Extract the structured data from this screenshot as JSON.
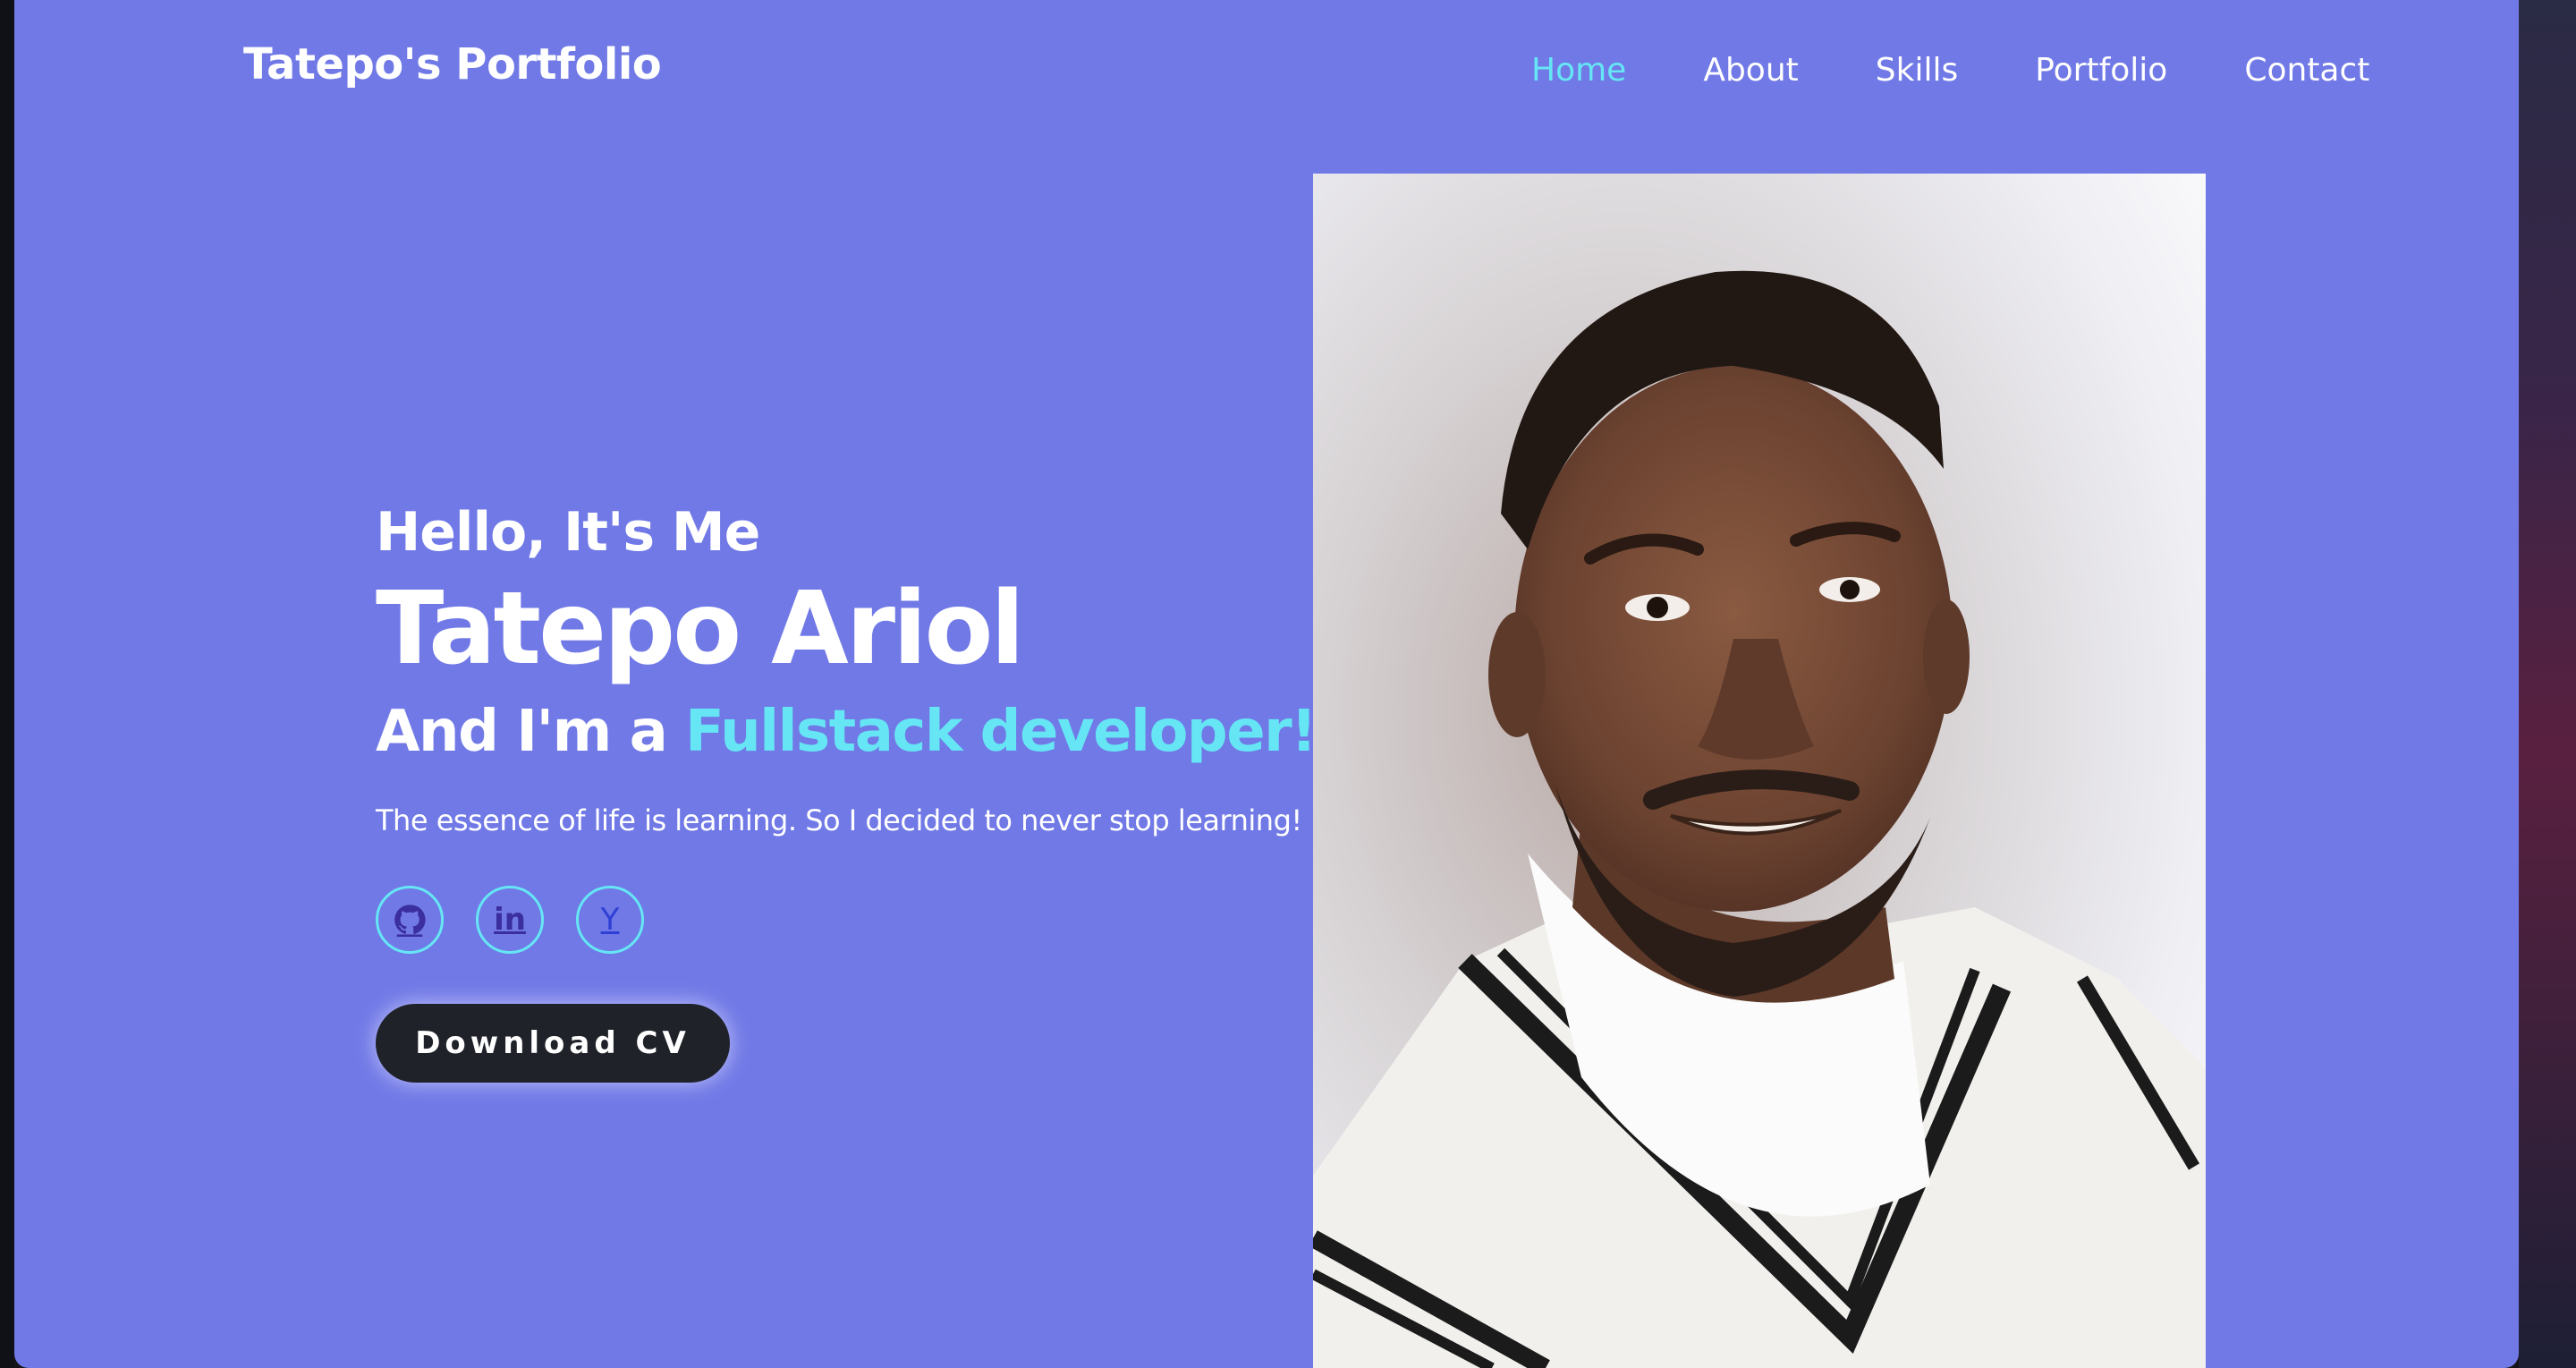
{
  "site": {
    "logo": "Tatepo's Portfolio"
  },
  "nav": {
    "items": [
      {
        "label": "Home",
        "active": true
      },
      {
        "label": "About",
        "active": false
      },
      {
        "label": "Skills",
        "active": false
      },
      {
        "label": "Portfolio",
        "active": false
      },
      {
        "label": "Contact",
        "active": false
      }
    ]
  },
  "hero": {
    "greeting": "Hello, It's Me",
    "name": "Tatepo Ariol",
    "role_prefix": "And I'm a",
    "role_highlight": "Fullstack developer!",
    "tagline": "The essence of life is learning. So I decided to never stop learning!",
    "socials": [
      {
        "icon": "github-icon"
      },
      {
        "icon": "linkedin-icon",
        "glyph": "in"
      },
      {
        "icon": "ycombinator-icon",
        "glyph": "Y"
      }
    ],
    "cv_button": "Download CV"
  },
  "colors": {
    "background": "#7079e6",
    "accent": "#66e6f4",
    "button": "#1f2228",
    "text": "#ffffff"
  }
}
